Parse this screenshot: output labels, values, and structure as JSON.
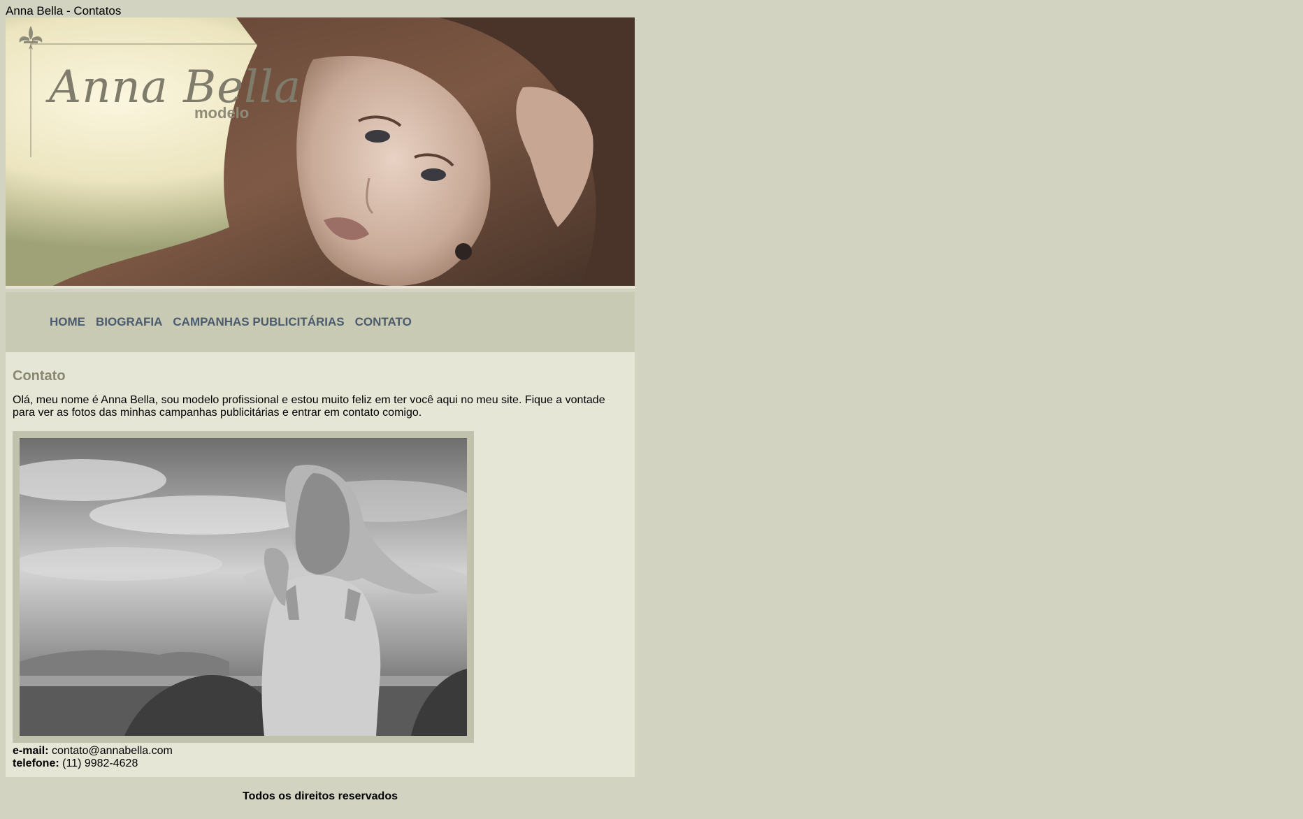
{
  "page": {
    "title": "Anna Bella - Contatos"
  },
  "banner": {
    "logo_title": "Anna Bella",
    "logo_subtitle": "modelo"
  },
  "nav": {
    "items": [
      {
        "label": "HOME"
      },
      {
        "label": "BIOGRAFIA"
      },
      {
        "label": "CAMPANHAS PUBLICITÁRIAS"
      },
      {
        "label": "CONTATO"
      }
    ]
  },
  "content": {
    "heading": "Contato",
    "intro": "Olá, meu nome é Anna Bella, sou modelo profissional e estou muito feliz em ter você aqui no meu site. Fique a vontade para ver as fotos das minhas campanhas publicitárias e entrar em contato comigo.",
    "email_label": "e-mail:",
    "email_value": "contato@annabella.com",
    "phone_label": "telefone:",
    "phone_value": "(11) 9982-4628"
  },
  "footer": {
    "text": "Todos os direitos reservados"
  },
  "colors": {
    "page_bg": "#d2d3c0",
    "nav_bg": "#c9cab3",
    "nav_text": "#4b5b6e",
    "content_bg": "#e6e6d7",
    "heading": "#8a8772",
    "photo_frame": "#c1c2ad"
  },
  "icons": {
    "logo": "fleur-de-lis-icon"
  }
}
